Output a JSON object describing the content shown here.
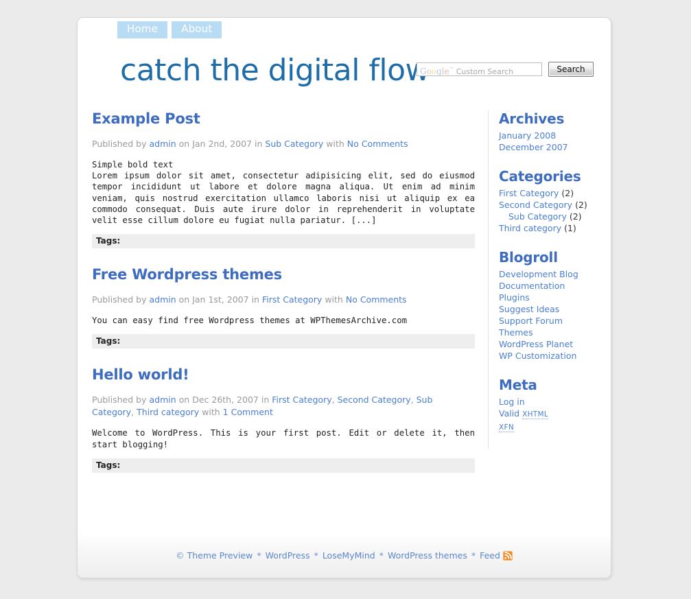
{
  "nav": {
    "items": [
      {
        "label": "Home"
      },
      {
        "label": "About"
      }
    ]
  },
  "header": {
    "site_title": "catch the digital flow",
    "search": {
      "watermark": "Google",
      "watermark_tm": "™",
      "watermark_label": "Custom Search",
      "input_value": "",
      "placeholder": "",
      "button_label": "Search"
    }
  },
  "posts": [
    {
      "title": "Example Post",
      "meta": {
        "published_by": "Published by",
        "author": "admin",
        "on": "on",
        "date": "Jan 2nd, 2007",
        "in": "in",
        "categories": [
          "Sub Category"
        ],
        "with": "with",
        "comments": "No Comments"
      },
      "lead": "Simple bold text",
      "body": "Lorem ipsum dolor sit amet, consectetur adipisicing elit, sed do eiusmod tempor incididunt ut labore et dolore magna aliqua. Ut enim ad minim veniam, quis nostrud exercitation ullamco laboris nisi ut aliquip ex ea commodo consequat. Duis aute irure dolor in reprehenderit in voluptate velit esse cillum dolore eu fugiat nulla pariatur. [...]",
      "tags_label": "Tags:"
    },
    {
      "title": "Free Wordpress themes",
      "meta": {
        "published_by": "Published by",
        "author": "admin",
        "on": "on",
        "date": "Jan 1st, 2007",
        "in": "in",
        "categories": [
          "First Category"
        ],
        "with": "with",
        "comments": "No Comments"
      },
      "lead": "",
      "body": "You can easy find free Wordpress themes at WPThemesArchive.com",
      "tags_label": "Tags:"
    },
    {
      "title": "Hello world!",
      "meta": {
        "published_by": "Published by",
        "author": "admin",
        "on": "on",
        "date": "Dec 26th, 2007",
        "in": "in",
        "categories": [
          "First Category",
          "Second Category",
          "Sub Category",
          "Third category"
        ],
        "with": "with",
        "comments": "1 Comment"
      },
      "lead": "",
      "body": "Welcome to WordPress. This is your first post. Edit or delete it, then start blogging!",
      "tags_label": "Tags:"
    }
  ],
  "sidebar": {
    "sections": [
      {
        "heading": "Archives",
        "items": [
          {
            "label": "January 2008",
            "count": ""
          },
          {
            "label": "December 2007",
            "count": ""
          }
        ]
      },
      {
        "heading": "Categories",
        "items": [
          {
            "label": "First Category",
            "count": "(2)",
            "indent": false
          },
          {
            "label": "Second Category",
            "count": "(2)",
            "indent": false
          },
          {
            "label": "Sub Category",
            "count": "(2)",
            "indent": true
          },
          {
            "label": "Third category",
            "count": "(1)",
            "indent": false
          }
        ]
      },
      {
        "heading": "Blogroll",
        "items": [
          {
            "label": "Development Blog",
            "count": ""
          },
          {
            "label": "Documentation",
            "count": ""
          },
          {
            "label": "Plugins",
            "count": ""
          },
          {
            "label": "Suggest Ideas",
            "count": ""
          },
          {
            "label": "Support Forum",
            "count": ""
          },
          {
            "label": "Themes",
            "count": ""
          },
          {
            "label": "WordPress Planet",
            "count": ""
          },
          {
            "label": "WP Customization",
            "count": ""
          }
        ]
      },
      {
        "heading": "Meta",
        "items": [
          {
            "label": "Log in",
            "count": ""
          },
          {
            "label": "Valid",
            "abbr": "XHTML",
            "count": ""
          },
          {
            "label": "",
            "abbr": "XFN",
            "count": ""
          }
        ]
      }
    ]
  },
  "footer": {
    "copyright_symbol": "©",
    "links": [
      {
        "label": "Theme Preview"
      },
      {
        "label": "WordPress"
      },
      {
        "label": "LoseMyMind"
      },
      {
        "label": "WordPress themes"
      },
      {
        "label": "Feed"
      }
    ],
    "separator": "*",
    "feed_icon": "rss-icon"
  },
  "colors": {
    "page_bg": "#ebebeb",
    "accent_heading": "#3e6cbf",
    "site_title": "#1f6da8",
    "link": "#4a7fd0",
    "nav_tab": "#b9dcf5",
    "tags_bar": "#eeeeee",
    "rss_orange": "#f08a24"
  }
}
